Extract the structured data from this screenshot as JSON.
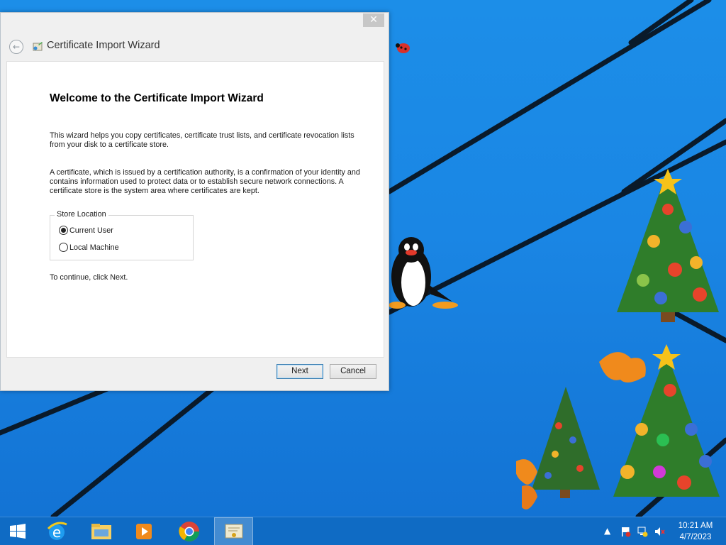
{
  "window": {
    "title": "Certificate Import Wizard",
    "close_label": "✕",
    "back_label": "←"
  },
  "page": {
    "heading": "Welcome to the Certificate Import Wizard",
    "paragraph1": "This wizard helps you copy certificates, certificate trust lists, and certificate revocation lists from your disk to a certificate store.",
    "paragraph2": "A certificate, which is issued by a certification authority, is a confirmation of your identity and contains information used to protect data or to establish secure network connections. A certificate store is the system area where certificates are kept.",
    "store_location": {
      "label": "Store Location",
      "options": [
        {
          "label": "Current User",
          "selected": true
        },
        {
          "label": "Local Machine",
          "selected": false
        }
      ]
    },
    "continue_text": "To continue, click Next."
  },
  "buttons": {
    "next": "Next",
    "cancel": "Cancel"
  },
  "taskbar": {
    "items": [
      "start-icon",
      "internet-explorer-icon",
      "file-explorer-icon",
      "media-player-icon",
      "chrome-icon",
      "certificate-wizard-icon"
    ],
    "clock_time": "10:21 AM",
    "clock_date": "4/7/2023"
  },
  "colors": {
    "desktop": "#1a86e4",
    "taskbar": "#0f6bc4",
    "default_button_border": "#3c7fb1"
  }
}
